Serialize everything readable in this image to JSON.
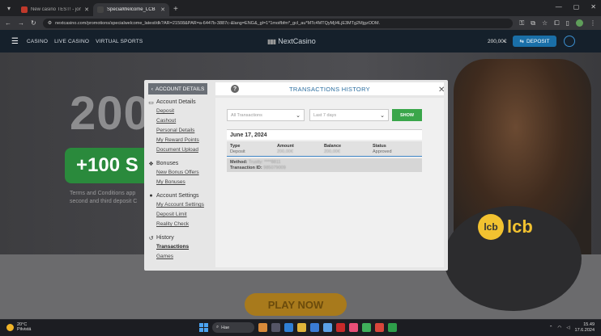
{
  "browser": {
    "tabs": [
      {
        "title": "New casino TEST! - jonvonliell",
        "active": false
      },
      {
        "title": "SpecialWelcome_LCB",
        "active": true
      }
    ],
    "url": "nextcasino.com/promotions/specialwelcome_latest/dk?AR=21508&PAR=a-6447b-3887c-&lang=ENG&_gl=1*1moifbfm*_gcl_au*MTc4MTQyMjI4LjE3MTg2MjgzODM."
  },
  "site": {
    "nav": [
      "CASINO",
      "LIVE CASINO",
      "VIRTUAL SPORTS"
    ],
    "logo": "NextCasino",
    "balance": "200,00€",
    "deposit_label": "DEPOSIT"
  },
  "background": {
    "big_text": "200",
    "pill_text": "+100 S",
    "terms_text": "Terms and Conditions app second and third deposit C",
    "lcb_text": "lcb",
    "lcb_mark": "lcb",
    "play_now": "PLAY NOW"
  },
  "modal": {
    "back_label": "ACCOUNT DETAILS",
    "title": "TRANSACTIONS HISTORY",
    "help_glyph": "?",
    "close_glyph": "✕",
    "sidebar": [
      {
        "heading": "Account Details",
        "icon": "user-icon",
        "links": [
          "Deposit",
          "Cashout",
          "Personal Details",
          "My Reward Points",
          "Document Upload"
        ]
      },
      {
        "heading": "Bonuses",
        "icon": "gift-icon",
        "links": [
          "New Bonus Offers",
          "My Bonuses"
        ]
      },
      {
        "heading": "Account Settings",
        "icon": "settings-icon",
        "links": [
          "My Account Settings",
          "Deposit Limit",
          "Reality Check"
        ]
      },
      {
        "heading": "History",
        "icon": "history-icon",
        "links": [
          "Transactions",
          "Games"
        ]
      }
    ],
    "filters": {
      "type_value": "All Transactions",
      "period_value": "Last 7 days",
      "show_label": "SHOW"
    },
    "transaction": {
      "date": "June 17, 2024",
      "columns": [
        {
          "header": "Type",
          "value": "Deposit"
        },
        {
          "header": "Amount",
          "value": "200,00€"
        },
        {
          "header": "Balance",
          "value": "200,00€"
        },
        {
          "header": "Status",
          "value": "Approved"
        }
      ],
      "method_label": "Method:",
      "method_value": "Trustly: ****8811",
      "txid_label": "Transaction ID:",
      "txid_value": "985079009"
    }
  },
  "taskbar": {
    "temperature": "20°C",
    "weather": "Pilvistä",
    "search_placeholder": "Hae",
    "time": "15.49",
    "date": "17.6.2024"
  }
}
